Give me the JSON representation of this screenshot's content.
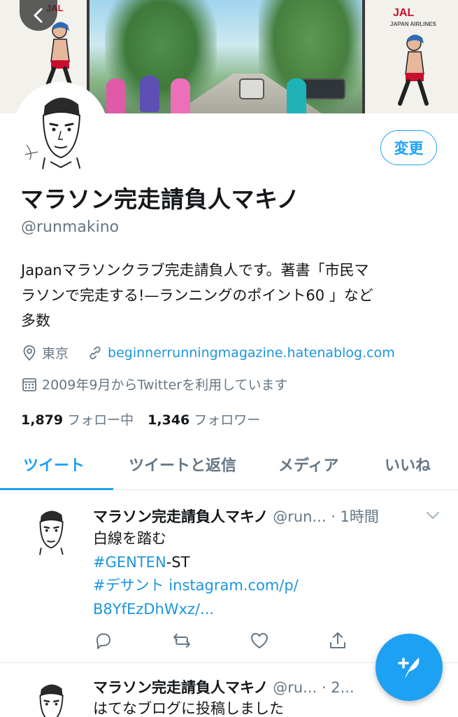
{
  "banner": {
    "left_brand": "JAL",
    "right_brand": "JAL",
    "right_brand_sub": "JAPAN AIRLINES"
  },
  "profile": {
    "edit_label": "変更",
    "display_name": "マラソン完走請負人マキノ",
    "handle": "@runmakino",
    "bio_lines": [
      "Japanマラソンクラブ完走請負人です。著書「市民マ",
      "ラソンで完走する!—ランニングのポイント60 」など",
      "多数"
    ],
    "location": "東京",
    "website": "beginnerrunningmagazine.hatenablog.com",
    "joined": "2009年9月からTwitterを利用しています",
    "following_count": "1,879",
    "following_label": "フォロー中",
    "followers_count": "1,346",
    "followers_label": "フォロワー"
  },
  "tabs": [
    {
      "label": "ツイート",
      "active": true
    },
    {
      "label": "ツイートと返信",
      "active": false
    },
    {
      "label": "メディア",
      "active": false
    },
    {
      "label": "いいね",
      "active": false
    }
  ],
  "tweets": [
    {
      "name": "マラソン完走請負人マキノ",
      "handle": "@run...",
      "time": "· 1時間",
      "line1": "白線を踏む",
      "hashtag1": "#GENTEN",
      "line2_rest": "-ST",
      "hashtag2": "#デサント",
      "link_part1": "instagram.com/p/",
      "link_part2": "B8YfEzDhWxz/..."
    },
    {
      "name": "マラソン完走請負人マキノ",
      "handle": "@ru...",
      "time": "· 2...",
      "line1": "はてなブログに投稿しました"
    }
  ],
  "colors": {
    "accent": "#1da1f2",
    "link": "#1b95e0",
    "muted": "#657786",
    "text": "#14171a"
  },
  "icons": [
    "back-arrow-icon",
    "location-pin-icon",
    "link-icon",
    "calendar-icon",
    "chevron-down-icon",
    "reply-icon",
    "retweet-icon",
    "like-icon",
    "share-icon",
    "compose-icon"
  ]
}
